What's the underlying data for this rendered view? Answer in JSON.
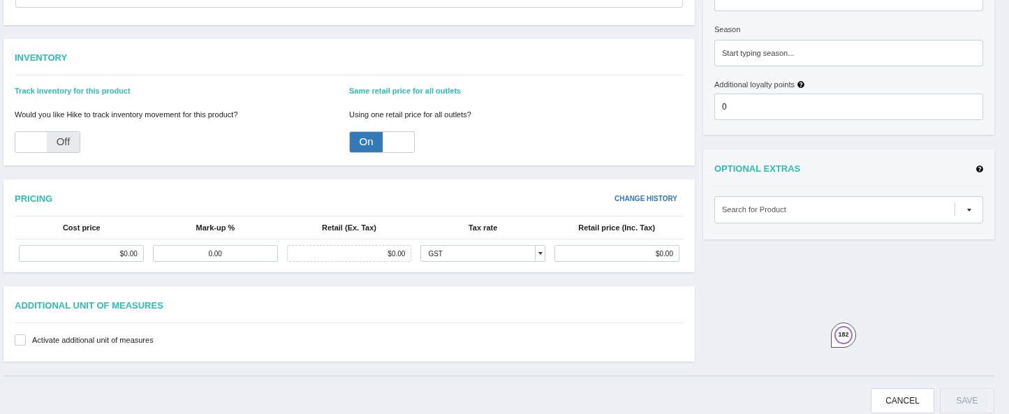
{
  "inventory": {
    "title": "INVENTORY",
    "settings": [
      {
        "heading": "Track inventory for this product",
        "question": "Would you like Hike to track inventory movement for this product?",
        "toggle_label": "Off",
        "on": false
      },
      {
        "heading": "Same retail price for all outlets",
        "question": "Using one retail price for all outlets?",
        "toggle_label": "On",
        "on": true
      }
    ]
  },
  "pricing": {
    "title": "PRICING",
    "link": "CHANGE HISTORY",
    "columns": [
      "Cost price",
      "Mark-up %",
      "Retail (Ex. Tax)",
      "Tax rate",
      "Retail price (Inc. Tax)"
    ],
    "fields": [
      {
        "kind": "money",
        "value": "$0.00"
      },
      {
        "kind": "percent",
        "value": "0.00"
      },
      {
        "kind": "readonly",
        "value": "$0.00"
      },
      {
        "kind": "select",
        "value": "GST"
      },
      {
        "kind": "money",
        "value": "$0.00"
      }
    ]
  },
  "unit_of_measures": {
    "title": "ADDITIONAL UNIT OF MEASURES",
    "checkbox": {
      "label": "Activate additional unit of measures",
      "checked": false
    }
  },
  "details": {
    "season": {
      "label": "Season",
      "placeholder": "Start typing season..."
    },
    "loyalty": {
      "label": "Additional loyalty points",
      "value": "0"
    }
  },
  "optional_extras": {
    "title": "OPTIONAL EXTRAS",
    "search": {
      "placeholder": "Search for Product"
    }
  },
  "badge": {
    "count": "182"
  },
  "buttons": [
    {
      "label": "CANCEL",
      "disabled": false
    },
    {
      "label": "SAVE",
      "disabled": true
    }
  ]
}
